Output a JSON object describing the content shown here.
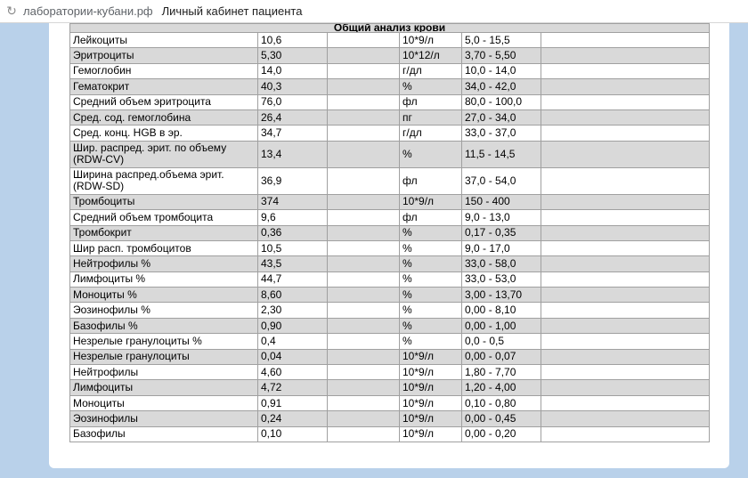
{
  "browser": {
    "reload_icon": "reload-icon",
    "domain": "лаборатории-кубани.рф",
    "page_title": "Личный кабинет пациента"
  },
  "report": {
    "section_title": "Общий анализ крови",
    "rows": [
      {
        "name": "Лейкоциты",
        "value": "10,6",
        "unit": "10*9/л",
        "range": "5,0 - 15,5"
      },
      {
        "name": "Эритроциты",
        "value": "5,30",
        "unit": "10*12/л",
        "range": "3,70 - 5,50"
      },
      {
        "name": "Гемоглобин",
        "value": "14,0",
        "unit": "г/дл",
        "range": "10,0 - 14,0"
      },
      {
        "name": "Гематокрит",
        "value": "40,3",
        "unit": "%",
        "range": "34,0 - 42,0"
      },
      {
        "name": "Средний объем эритроцита",
        "value": "76,0",
        "unit": "фл",
        "range": "80,0 - 100,0"
      },
      {
        "name": "Сред. сод. гемоглобина",
        "value": "26,4",
        "unit": "пг",
        "range": "27,0 - 34,0"
      },
      {
        "name": "Сред. конц. HGB в эр.",
        "value": "34,7",
        "unit": "г/дл",
        "range": "33,0 - 37,0"
      },
      {
        "name": "Шир. распред. эрит. по объему (RDW-CV)",
        "value": "13,4",
        "unit": "%",
        "range": "11,5 - 14,5"
      },
      {
        "name": "Ширина распред.объема эрит. (RDW-SD)",
        "value": "36,9",
        "unit": "фл",
        "range": "37,0 - 54,0"
      },
      {
        "name": "Тромбоциты",
        "value": "374",
        "unit": "10*9/л",
        "range": "150 - 400"
      },
      {
        "name": "Средний объем тромбоцита",
        "value": "9,6",
        "unit": "фл",
        "range": "9,0 - 13,0"
      },
      {
        "name": "Тромбокрит",
        "value": "0,36",
        "unit": "%",
        "range": "0,17 - 0,35"
      },
      {
        "name": "Шир расп. тромбоцитов",
        "value": "10,5",
        "unit": "%",
        "range": "9,0 - 17,0"
      },
      {
        "name": "Нейтрофилы %",
        "value": "43,5",
        "unit": "%",
        "range": "33,0 - 58,0"
      },
      {
        "name": "Лимфоциты %",
        "value": "44,7",
        "unit": "%",
        "range": "33,0 - 53,0"
      },
      {
        "name": "Моноциты %",
        "value": "8,60",
        "unit": "%",
        "range": "3,00 - 13,70"
      },
      {
        "name": "Эозинофилы %",
        "value": "2,30",
        "unit": "%",
        "range": "0,00 - 8,10"
      },
      {
        "name": "Базофилы %",
        "value": "0,90",
        "unit": "%",
        "range": "0,00 - 1,00"
      },
      {
        "name": "Незрелые гранулоциты %",
        "value": "0,4",
        "unit": "%",
        "range": "0,0 - 0,5"
      },
      {
        "name": "Незрелые гранулоциты",
        "value": "0,04",
        "unit": "10*9/л",
        "range": "0,00 - 0,07"
      },
      {
        "name": "Нейтрофилы",
        "value": "4,60",
        "unit": "10*9/л",
        "range": "1,80 - 7,70"
      },
      {
        "name": "Лимфоциты",
        "value": "4,72",
        "unit": "10*9/л",
        "range": "1,20 - 4,00"
      },
      {
        "name": "Моноциты",
        "value": "0,91",
        "unit": "10*9/л",
        "range": "0,10 - 0,80"
      },
      {
        "name": "Эозинофилы",
        "value": "0,24",
        "unit": "10*9/л",
        "range": "0,00 - 0,45"
      },
      {
        "name": "Базофилы",
        "value": "0,10",
        "unit": "10*9/л",
        "range": "0,00 - 0,20"
      }
    ]
  }
}
